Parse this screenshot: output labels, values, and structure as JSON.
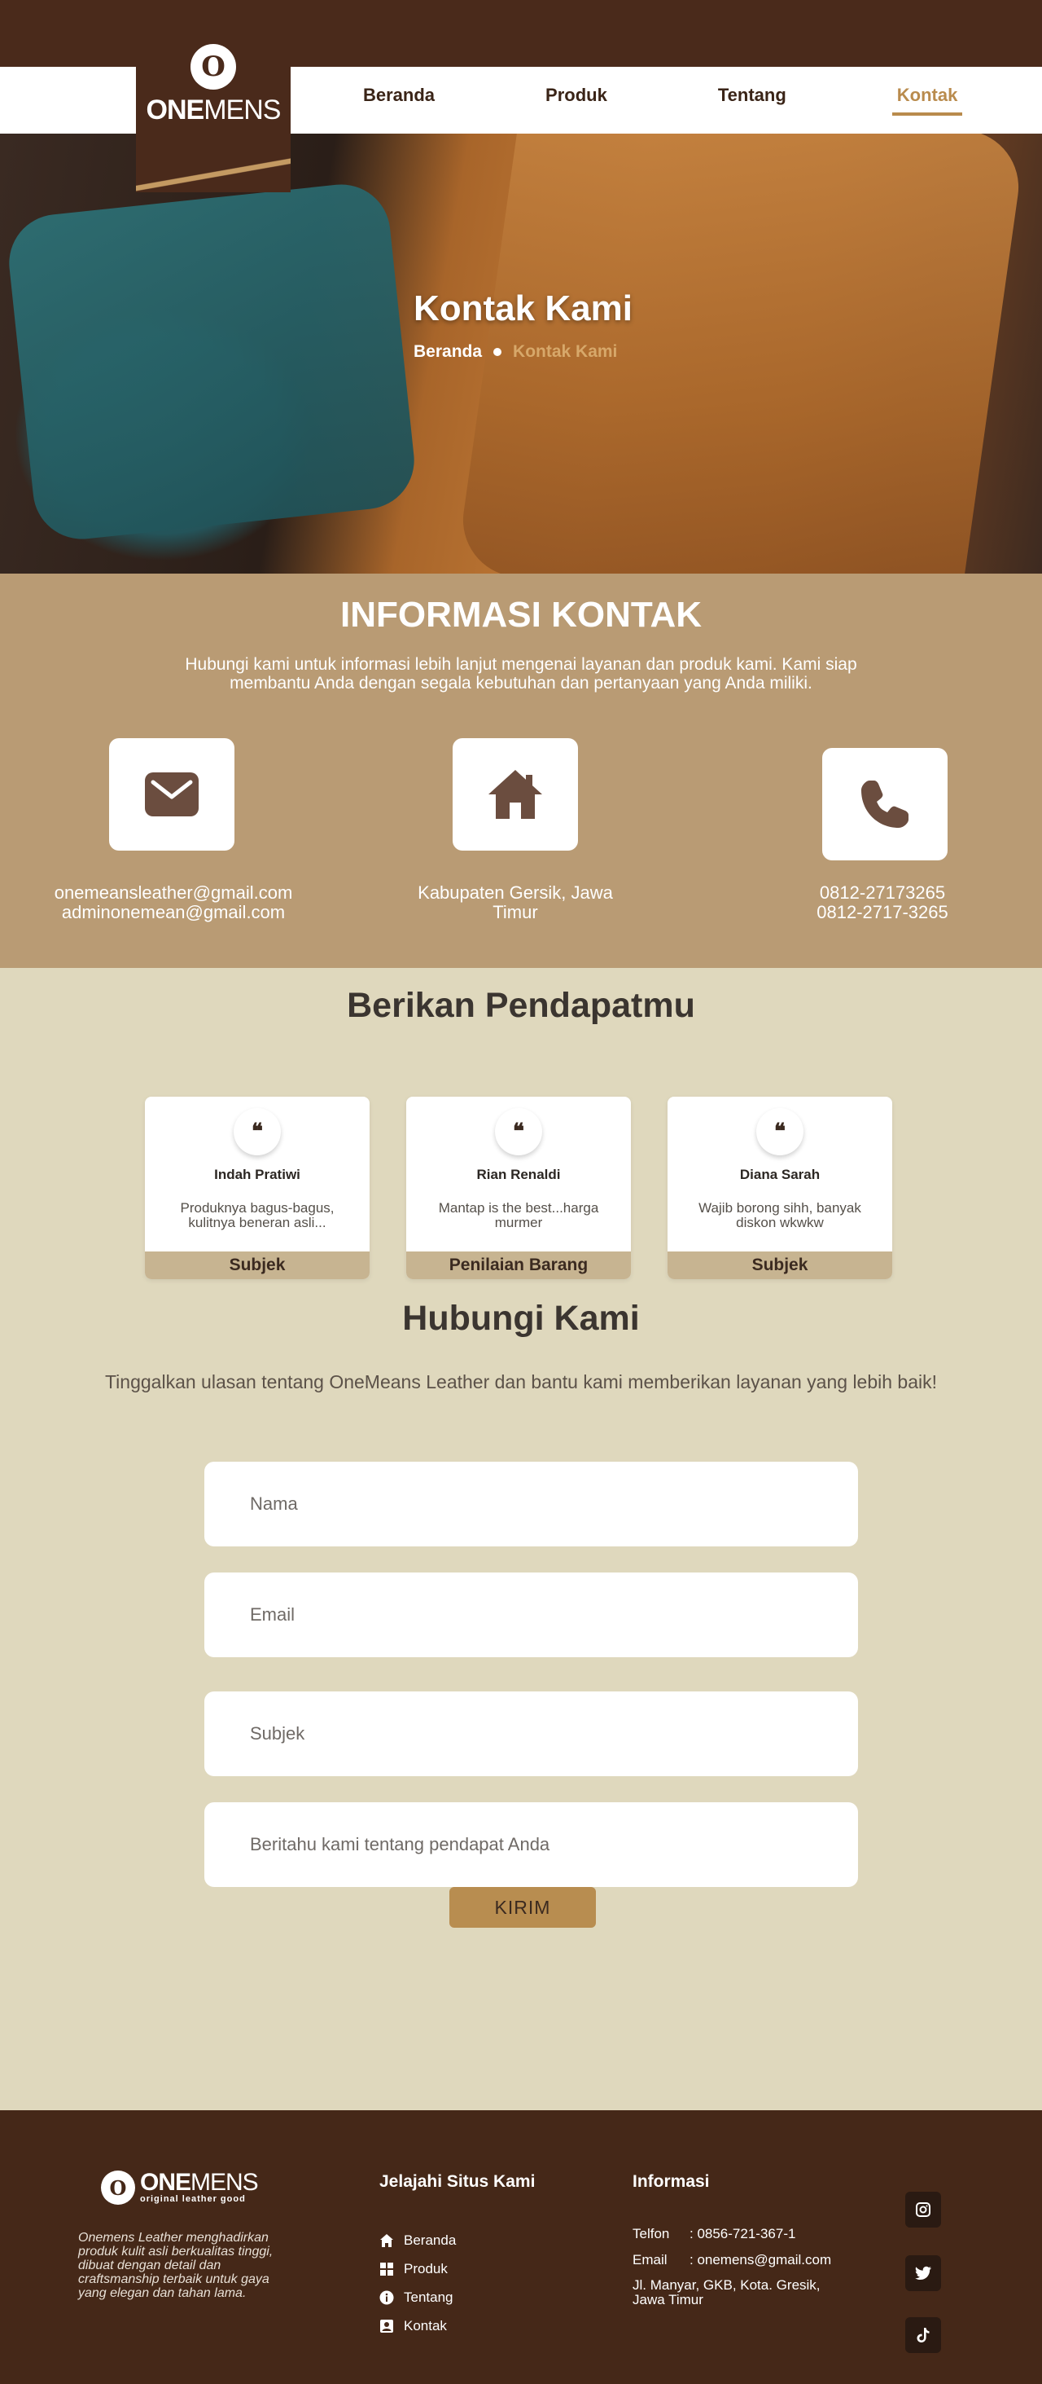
{
  "brand": {
    "logo_letter": "O",
    "name_bold": "ONE",
    "name_rest": "MENS",
    "tagline": "original leather good"
  },
  "nav": {
    "items": [
      {
        "label": "Beranda"
      },
      {
        "label": "Produk"
      },
      {
        "label": "Tentang"
      },
      {
        "label": "Kontak"
      }
    ],
    "active": "Kontak"
  },
  "hero": {
    "title": "Kontak Kami",
    "breadcrumb_home": "Beranda",
    "breadcrumb_current": "Kontak Kami"
  },
  "info": {
    "title": "INFORMASI KONTAK",
    "description": "Hubungi kami untuk informasi lebih lanjut mengenai layanan dan produk kami. Kami siap membantu Anda dengan segala kebutuhan dan pertanyaan yang Anda miliki.",
    "email_lines": [
      "onemeansleather@gmail.com",
      "adminonemean@gmail.com"
    ],
    "address": "Kabupaten Gersik, Jawa Timur",
    "phone_lines": [
      "0812-27173265",
      "0812-2717-3265"
    ],
    "icons": [
      "envelope-icon",
      "home-icon",
      "phone-icon"
    ]
  },
  "opinions": {
    "title": "Berikan Pendapatmu",
    "quote_glyph": "❝",
    "reviews": [
      {
        "name": "Indah Pratiwi",
        "text": "Produknya bagus-bagus, kulitnya beneran asli...",
        "footer": "Subjek"
      },
      {
        "name": "Rian Renaldi",
        "text": "Mantap is the best...harga murmer",
        "footer": "Penilaian Barang"
      },
      {
        "name": "Diana Sarah",
        "text": "Wajib borong sihh, banyak diskon wkwkw",
        "footer": "Subjek"
      }
    ]
  },
  "contact": {
    "title": "Hubungi Kami",
    "subtitle": "Tinggalkan ulasan tentang OneMeans Leather dan bantu kami memberikan layanan yang lebih baik!",
    "name_placeholder": "Nama",
    "email_placeholder": "Email",
    "subject_placeholder": "Subjek",
    "message_placeholder": "Beritahu kami tentang pendapat Anda",
    "submit_label": "KIRIM"
  },
  "footer": {
    "about": "Onemens Leather menghadirkan produk kulit asli berkualitas tinggi, dibuat dengan detail dan craftsmanship terbaik untuk gaya yang elegan dan tahan lama.",
    "explore_title": "Jelajahi Situs Kami",
    "links": [
      {
        "label": "Beranda",
        "icon": "home-icon"
      },
      {
        "label": "Produk",
        "icon": "grid-icon"
      },
      {
        "label": "Tentang",
        "icon": "info-icon"
      },
      {
        "label": "Kontak",
        "icon": "contact-card-icon"
      }
    ],
    "info_title": "Informasi",
    "phone_key": "Telfon",
    "phone_value": ": 0856-721-367-1",
    "email_key": "Email",
    "email_value": ": onemens@gmail.com",
    "address": "Jl. Manyar, GKB, Kota. Gresik, Jawa Timur",
    "social": [
      "instagram-icon",
      "twitter-icon",
      "tiktok-icon"
    ]
  },
  "colors": {
    "dark_brown": "#4a2a1b",
    "gold": "#b98b4d",
    "tan": "#b99b74",
    "cream": "#dfd8bd",
    "footer_bg": "#452818"
  }
}
